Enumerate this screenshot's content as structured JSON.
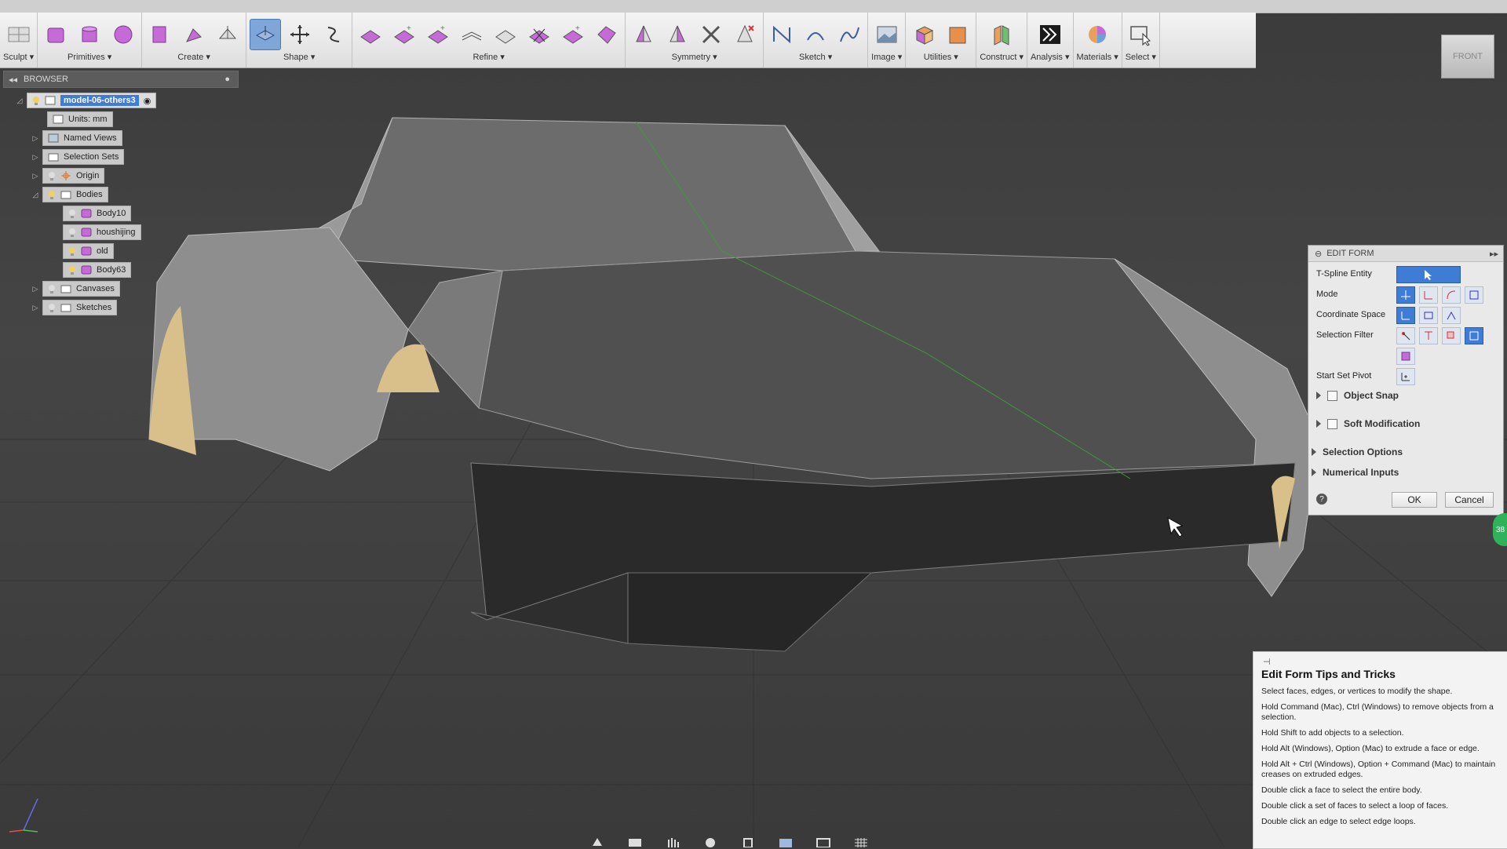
{
  "toolbar": {
    "groups": [
      {
        "label": "Sculpt ▾"
      },
      {
        "label": "Primitives ▾"
      },
      {
        "label": "Create ▾"
      },
      {
        "label": "Shape ▾"
      },
      {
        "label": "Refine ▾"
      },
      {
        "label": "Symmetry ▾"
      },
      {
        "label": "Sketch ▾"
      },
      {
        "label": "Image ▾"
      },
      {
        "label": "Utilities ▾"
      },
      {
        "label": "Construct ▾"
      },
      {
        "label": "Analysis ▾"
      },
      {
        "label": "Materials ▾"
      },
      {
        "label": "Select ▾"
      }
    ]
  },
  "browser": {
    "title": "BROWSER",
    "items": [
      {
        "label": "model-06-others3"
      },
      {
        "label": "Units: mm"
      },
      {
        "label": "Named Views"
      },
      {
        "label": "Selection Sets"
      },
      {
        "label": "Origin"
      },
      {
        "label": "Bodies"
      },
      {
        "label": "Body10"
      },
      {
        "label": "houshijing"
      },
      {
        "label": "old"
      },
      {
        "label": "Body63"
      },
      {
        "label": "Canvases"
      },
      {
        "label": "Sketches"
      }
    ]
  },
  "viewcube": {
    "label": "FRONT"
  },
  "edit_form": {
    "title": "EDIT FORM",
    "tspline_entity": "T-Spline Entity",
    "mode": "Mode",
    "coordinate_space": "Coordinate Space",
    "selection_filter": "Selection Filter",
    "start_set_pivot": "Start Set Pivot",
    "object_snap": "Object Snap",
    "soft_modification": "Soft Modification",
    "selection_options": "Selection Options",
    "numerical_inputs": "Numerical Inputs",
    "ok": "OK",
    "cancel": "Cancel",
    "help": "?"
  },
  "tips": {
    "title": "Edit Form Tips and Tricks",
    "lines": [
      "Select faces, edges, or vertices to modify the shape.",
      "Hold Command (Mac), Ctrl (Windows) to remove objects from a selection.",
      "Hold Shift to add objects to a selection.",
      "Hold Alt (Windows), Option (Mac) to extrude a face or edge.",
      "Hold Alt + Ctrl (Windows), Option + Command (Mac) to maintain creases on extruded edges.",
      "Double click a face to select the entire body.",
      "Double click a set of faces to select a loop of faces.",
      "Double click an edge to select edge loops."
    ]
  },
  "status": {
    "badge": "38"
  },
  "colors": {
    "accent": "#3e7cd6",
    "model_gray": "#8c8c8c",
    "wheel_arch": "#d9c08a",
    "green_edge": "#3c9a3c"
  }
}
